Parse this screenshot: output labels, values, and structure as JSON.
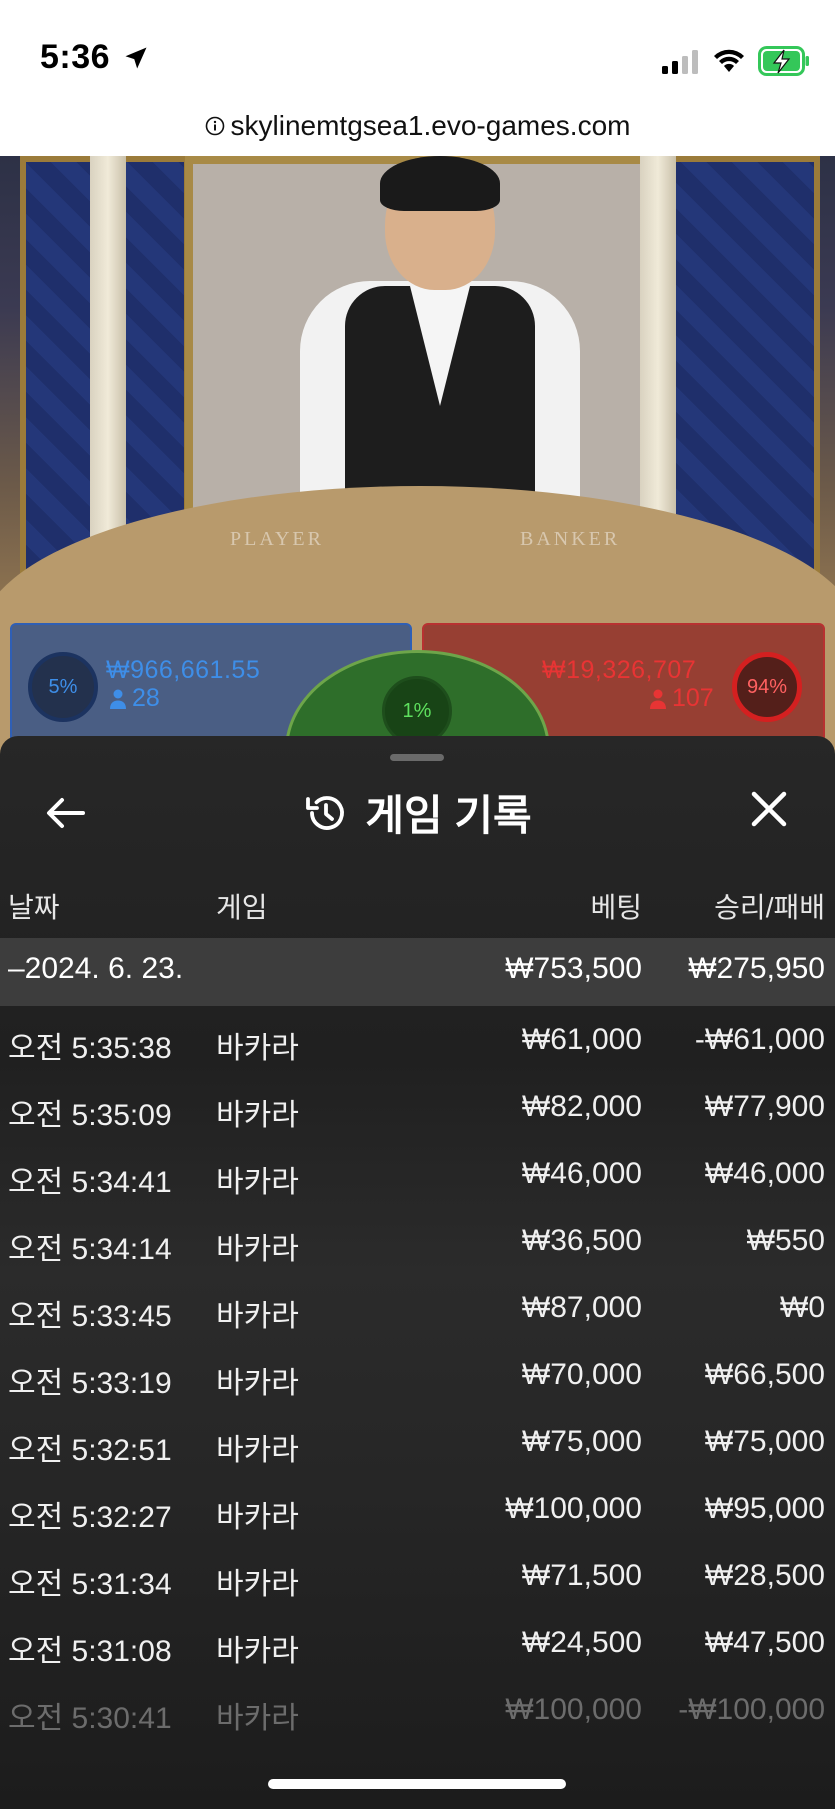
{
  "status": {
    "time": "5:36",
    "icons": [
      "location-arrow-icon",
      "signal-icon",
      "wifi-icon",
      "battery-charging-icon"
    ],
    "url": "skylinemtgsea1.evo-games.com"
  },
  "video": {
    "table_left_word": "PLAYER",
    "table_right_word": "BANKER"
  },
  "bets": {
    "player": {
      "percent": "5%",
      "amount": "₩966,661.55",
      "players": "28",
      "color": "#3e8ee8"
    },
    "tie": {
      "percent": "1%",
      "color": "#5ee05e"
    },
    "banker": {
      "percent": "94%",
      "amount": "₩19,326,707",
      "players": "107",
      "color": "#e83434"
    }
  },
  "sheet": {
    "title": "게임 기록",
    "columns": {
      "date": "날짜",
      "game": "게임",
      "bet": "베팅",
      "result": "승리/패배"
    },
    "summary": {
      "date": "–2024. 6. 23.",
      "bet": "₩753,500",
      "result": "₩275,950"
    },
    "rows": [
      {
        "time": "오전 5:35:38",
        "game": "바카라",
        "bet": "₩61,000",
        "result": "-₩61,000"
      },
      {
        "time": "오전 5:35:09",
        "game": "바카라",
        "bet": "₩82,000",
        "result": "₩77,900"
      },
      {
        "time": "오전 5:34:41",
        "game": "바카라",
        "bet": "₩46,000",
        "result": "₩46,000"
      },
      {
        "time": "오전 5:34:14",
        "game": "바카라",
        "bet": "₩36,500",
        "result": "₩550"
      },
      {
        "time": "오전 5:33:45",
        "game": "바카라",
        "bet": "₩87,000",
        "result": "₩0"
      },
      {
        "time": "오전 5:33:19",
        "game": "바카라",
        "bet": "₩70,000",
        "result": "₩66,500"
      },
      {
        "time": "오전 5:32:51",
        "game": "바카라",
        "bet": "₩75,000",
        "result": "₩75,000"
      },
      {
        "time": "오전 5:32:27",
        "game": "바카라",
        "bet": "₩100,000",
        "result": "₩95,000"
      },
      {
        "time": "오전 5:31:34",
        "game": "바카라",
        "bet": "₩71,500",
        "result": "₩28,500"
      },
      {
        "time": "오전 5:31:08",
        "game": "바카라",
        "bet": "₩24,500",
        "result": "₩47,500"
      },
      {
        "time": "오전 5:30:41",
        "game": "바카라",
        "bet": "₩100,000",
        "result": "-₩100,000"
      }
    ]
  }
}
